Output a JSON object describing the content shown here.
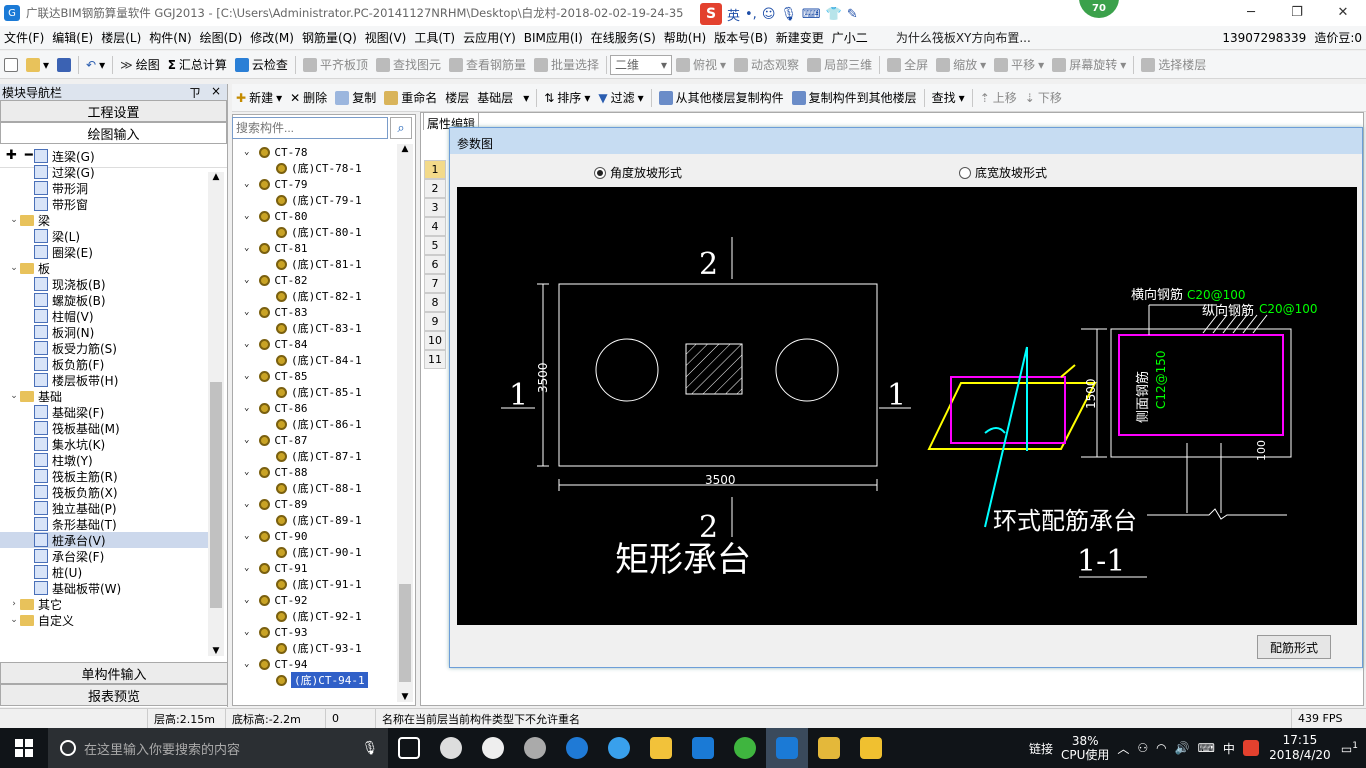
{
  "window": {
    "title": "广联达BIM钢筋算量软件 GGJ2013 - [C:\\Users\\Administrator.PC-20141127NRHM\\Desktop\\白龙村-2018-02-02-19-24-35",
    "badge": "70",
    "ime": {
      "mode": "英"
    }
  },
  "menu": [
    "文件(F)",
    "编辑(E)",
    "楼层(L)",
    "构件(N)",
    "绘图(D)",
    "修改(M)",
    "钢筋量(Q)",
    "视图(V)",
    "工具(T)",
    "云应用(Y)",
    "BIM应用(I)",
    "在线服务(S)",
    "帮助(H)",
    "版本号(B)",
    "新建变更",
    "广小二",
    "为什么筏板XY方向布置...",
    "13907298339",
    "造价豆:0"
  ],
  "toolbar1": {
    "draw": "绘图",
    "sum": "汇总计算",
    "cloudcheck": "云检查",
    "flat_top": "平齐板顶",
    "find_elem": "查找图元",
    "view_rebar": "查看钢筋量",
    "batch": "批量选择",
    "view2d": "二维",
    "topview": "俯视",
    "dynamic": "动态观察",
    "local3d": "局部三维",
    "fullscreen": "全屏",
    "zoom": "缩放",
    "pan": "平移",
    "rotate": "屏幕旋转",
    "choose_floor": "选择楼层"
  },
  "toolbar2": {
    "new": "新建",
    "delete": "删除",
    "copy": "复制",
    "rename": "重命名",
    "floor_label": "楼层",
    "floor_value": "基础层",
    "sort": "排序",
    "filter": "过滤",
    "copy_from": "从其他楼层复制构件",
    "copy_to": "复制构件到其他楼层",
    "find": "查找",
    "up": "上移",
    "down": "下移"
  },
  "nav": {
    "title": "模块导航栏",
    "pin": "ㄗ",
    "close": "×",
    "tabs": [
      "工程设置",
      "绘图输入"
    ],
    "bottom_tabs": [
      "单构件输入",
      "报表预览"
    ],
    "tree": [
      {
        "level": 2,
        "label": "连梁(G)"
      },
      {
        "level": 2,
        "label": "过梁(G)"
      },
      {
        "level": 2,
        "label": "带形洞"
      },
      {
        "level": 2,
        "label": "带形窗"
      },
      {
        "level": 1,
        "label": "梁",
        "folder": true
      },
      {
        "level": 2,
        "label": "梁(L)"
      },
      {
        "level": 2,
        "label": "圈梁(E)"
      },
      {
        "level": 1,
        "label": "板",
        "folder": true
      },
      {
        "level": 2,
        "label": "现浇板(B)"
      },
      {
        "level": 2,
        "label": "螺旋板(B)"
      },
      {
        "level": 2,
        "label": "柱帽(V)"
      },
      {
        "level": 2,
        "label": "板洞(N)"
      },
      {
        "level": 2,
        "label": "板受力筋(S)"
      },
      {
        "level": 2,
        "label": "板负筋(F)"
      },
      {
        "level": 2,
        "label": "楼层板带(H)"
      },
      {
        "level": 1,
        "label": "基础",
        "folder": true
      },
      {
        "level": 2,
        "label": "基础梁(F)"
      },
      {
        "level": 2,
        "label": "筏板基础(M)"
      },
      {
        "level": 2,
        "label": "集水坑(K)"
      },
      {
        "level": 2,
        "label": "柱墩(Y)"
      },
      {
        "level": 2,
        "label": "筏板主筋(R)"
      },
      {
        "level": 2,
        "label": "筏板负筋(X)"
      },
      {
        "level": 2,
        "label": "独立基础(P)"
      },
      {
        "level": 2,
        "label": "条形基础(T)"
      },
      {
        "level": 2,
        "label": "桩承台(V)",
        "selected": true
      },
      {
        "level": 2,
        "label": "承台梁(F)"
      },
      {
        "level": 2,
        "label": "桩(U)"
      },
      {
        "level": 2,
        "label": "基础板带(W)"
      },
      {
        "level": 1,
        "label": "其它",
        "folder": true,
        "collapsed": true
      },
      {
        "level": 1,
        "label": "自定义",
        "folder": true
      }
    ]
  },
  "components": {
    "search_placeholder": "搜索构件...",
    "items": [
      "CT-78",
      "(底)CT-78-1",
      "CT-79",
      "(底)CT-79-1",
      "CT-80",
      "(底)CT-80-1",
      "CT-81",
      "(底)CT-81-1",
      "CT-82",
      "(底)CT-82-1",
      "CT-83",
      "(底)CT-83-1",
      "CT-84",
      "(底)CT-84-1",
      "CT-85",
      "(底)CT-85-1",
      "CT-86",
      "(底)CT-86-1",
      "CT-87",
      "(底)CT-87-1",
      "CT-88",
      "(底)CT-88-1",
      "CT-89",
      "(底)CT-89-1",
      "CT-90",
      "(底)CT-90-1",
      "CT-91",
      "(底)CT-91-1",
      "CT-92",
      "(底)CT-92-1",
      "CT-93",
      "(底)CT-93-1",
      "CT-94",
      "(底)CT-94-1"
    ]
  },
  "properties": {
    "tab": "属性编辑",
    "rows": [
      "1",
      "2",
      "3",
      "4",
      "5",
      "6",
      "7",
      "8",
      "9",
      "10",
      "11"
    ]
  },
  "dialog": {
    "title": "参数图",
    "radio_angle": "角度放坡形式",
    "radio_width": "底宽放坡形式",
    "button": "配筋形式",
    "drawing": {
      "sec_top": "2",
      "sec_bottom": "2",
      "sec_left": "1",
      "sec_right": "1",
      "dim_h": "3500",
      "dim_w": "3500",
      "caption_left": "矩形承台",
      "caption_right": "环式配筋承台",
      "section_label": "1-1",
      "label_horizontal": "横向钢筋",
      "label_horizontal_val": "C20@100",
      "label_vertical": "纵向钢筋",
      "label_vertical_val": "C20@100",
      "label_side": "侧面钢筋",
      "label_side_val": "C12@150",
      "dim_1500": "1500",
      "dim_100": "100"
    }
  },
  "status": {
    "floor_height": "层高:2.15m",
    "bottom_height": "底标高:-2.2m",
    "count": "0",
    "message": "名称在当前层当前构件类型下不允许重名",
    "fps": "439 FPS"
  },
  "taskbar": {
    "search_placeholder": "在这里输入你要搜索的内容",
    "link": "链接",
    "cpu_percent": "38%",
    "cpu_label": "CPU使用",
    "lang": "中",
    "time": "17:15",
    "date": "2018/4/20",
    "notif": "1"
  }
}
